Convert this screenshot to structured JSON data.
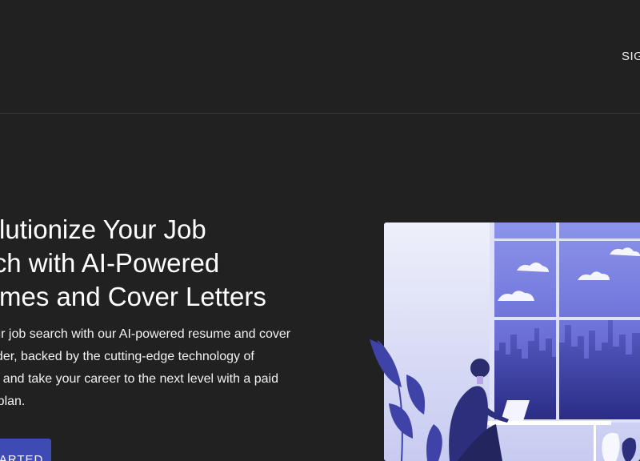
{
  "header": {
    "sign_link": "SIG"
  },
  "hero": {
    "title_lines": [
      "Revolutionize Your Job",
      "Search with AI-Powered",
      "Resumes and Cover Letters"
    ],
    "description": "Boost your job search with our AI-powered resume and cover letter builder, backed by the cutting-edge technology of ChatGPT, and take your career to the next level with a paid premium plan.",
    "cta_label": "GET STARTED"
  },
  "colors": {
    "background": "#212121",
    "accent": "#3f4bb5",
    "illustration_primary": "#3b3f9a"
  },
  "icons": {
    "illustration": "person-at-laptop-by-window-illustration"
  }
}
